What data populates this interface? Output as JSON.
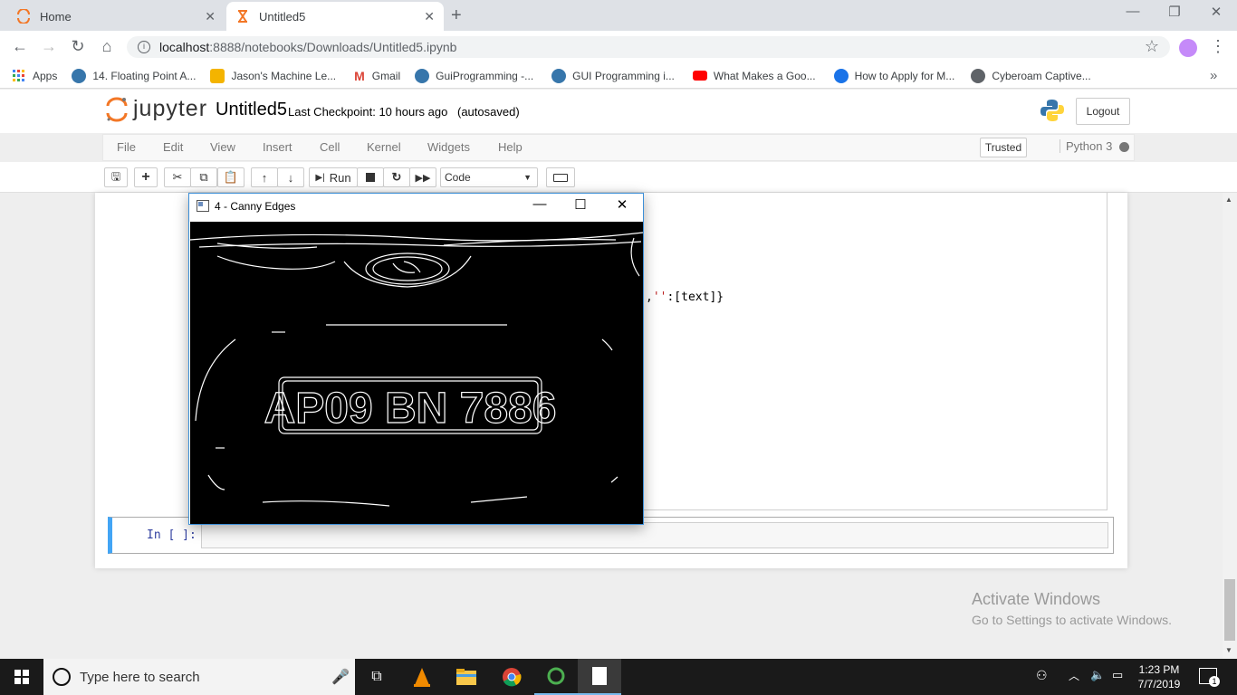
{
  "browser": {
    "tabs": [
      {
        "title": "Home",
        "close": "✕"
      },
      {
        "title": "Untitled5",
        "close": "✕"
      }
    ],
    "new_tab": "+",
    "window_controls": {
      "minimize": "—",
      "restore": "❐",
      "close": "✕"
    },
    "url_host": "localhost",
    "url_path": ":8888/notebooks/Downloads/Untitled5.ipynb",
    "bookmarks": [
      {
        "label": "Apps",
        "color": "#4285f4"
      },
      {
        "label": "14. Floating Point A...",
        "color": "#3776ab"
      },
      {
        "label": "Jason's Machine Le...",
        "color": "#f4b400"
      },
      {
        "label": "Gmail",
        "color": "#db4437"
      },
      {
        "label": "GuiProgramming -...",
        "color": "#3776ab"
      },
      {
        "label": "GUI Programming i...",
        "color": "#3776ab"
      },
      {
        "label": "What Makes a Goo...",
        "color": "#ff0000"
      },
      {
        "label": "How to Apply for M...",
        "color": "#1a73e8"
      },
      {
        "label": "Cyberoam Captive...",
        "color": "#5f6368"
      }
    ],
    "bookmarks_more": "»"
  },
  "jupyter": {
    "logo_text": "jupyter",
    "notebook_name": "Untitled5",
    "checkpoint": "Last Checkpoint: 10 hours ago",
    "autosaved": "(autosaved)",
    "logout": "Logout",
    "menu": [
      "File",
      "Edit",
      "View",
      "Insert",
      "Cell",
      "Kernel",
      "Widgets",
      "Help"
    ],
    "trusted": "Trusted",
    "kernel_name": "Python 3",
    "run_label": "Run",
    "cell_type": "Code",
    "output_text_pre": ",",
    "output_text_str": "''",
    "output_text_post": ":[text]}",
    "prompt": "In [ ]:"
  },
  "popup": {
    "title": "4 - Canny Edges",
    "plate_text": "AP09 BN 7886"
  },
  "watermark": {
    "line1": "Activate Windows",
    "line2": "Go to Settings to activate Windows."
  },
  "taskbar": {
    "search_placeholder": "Type here to search",
    "time": "1:23 PM",
    "date": "7/7/2019",
    "notification_count": "1"
  }
}
